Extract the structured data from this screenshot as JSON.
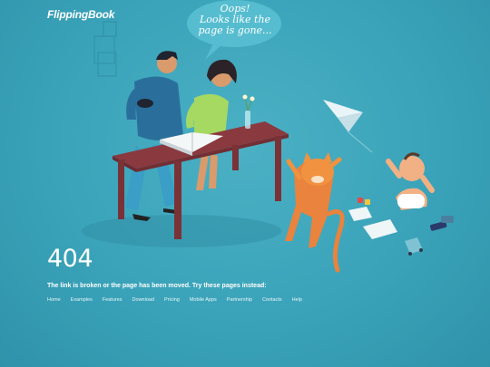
{
  "brand": {
    "logo_text": "FlippingBook"
  },
  "illustration": {
    "speech_bubble": {
      "line1": "Oops!",
      "line2": "Looks like the",
      "line3": "page is gone..."
    }
  },
  "error": {
    "code": "404",
    "message": "The link is broken or the page has been moved. Try these pages instead:"
  },
  "nav": {
    "links": [
      "Home",
      "Examples",
      "Features",
      "Download",
      "Pricing",
      "Mobile Apps",
      "Partnership",
      "Contacts",
      "Help"
    ]
  },
  "colors": {
    "background": "#3aa3b9",
    "table": "#8a3a3f",
    "cat": "#e9833d",
    "man_shirt": "#2a6f9b",
    "woman_shirt": "#a6d962"
  }
}
